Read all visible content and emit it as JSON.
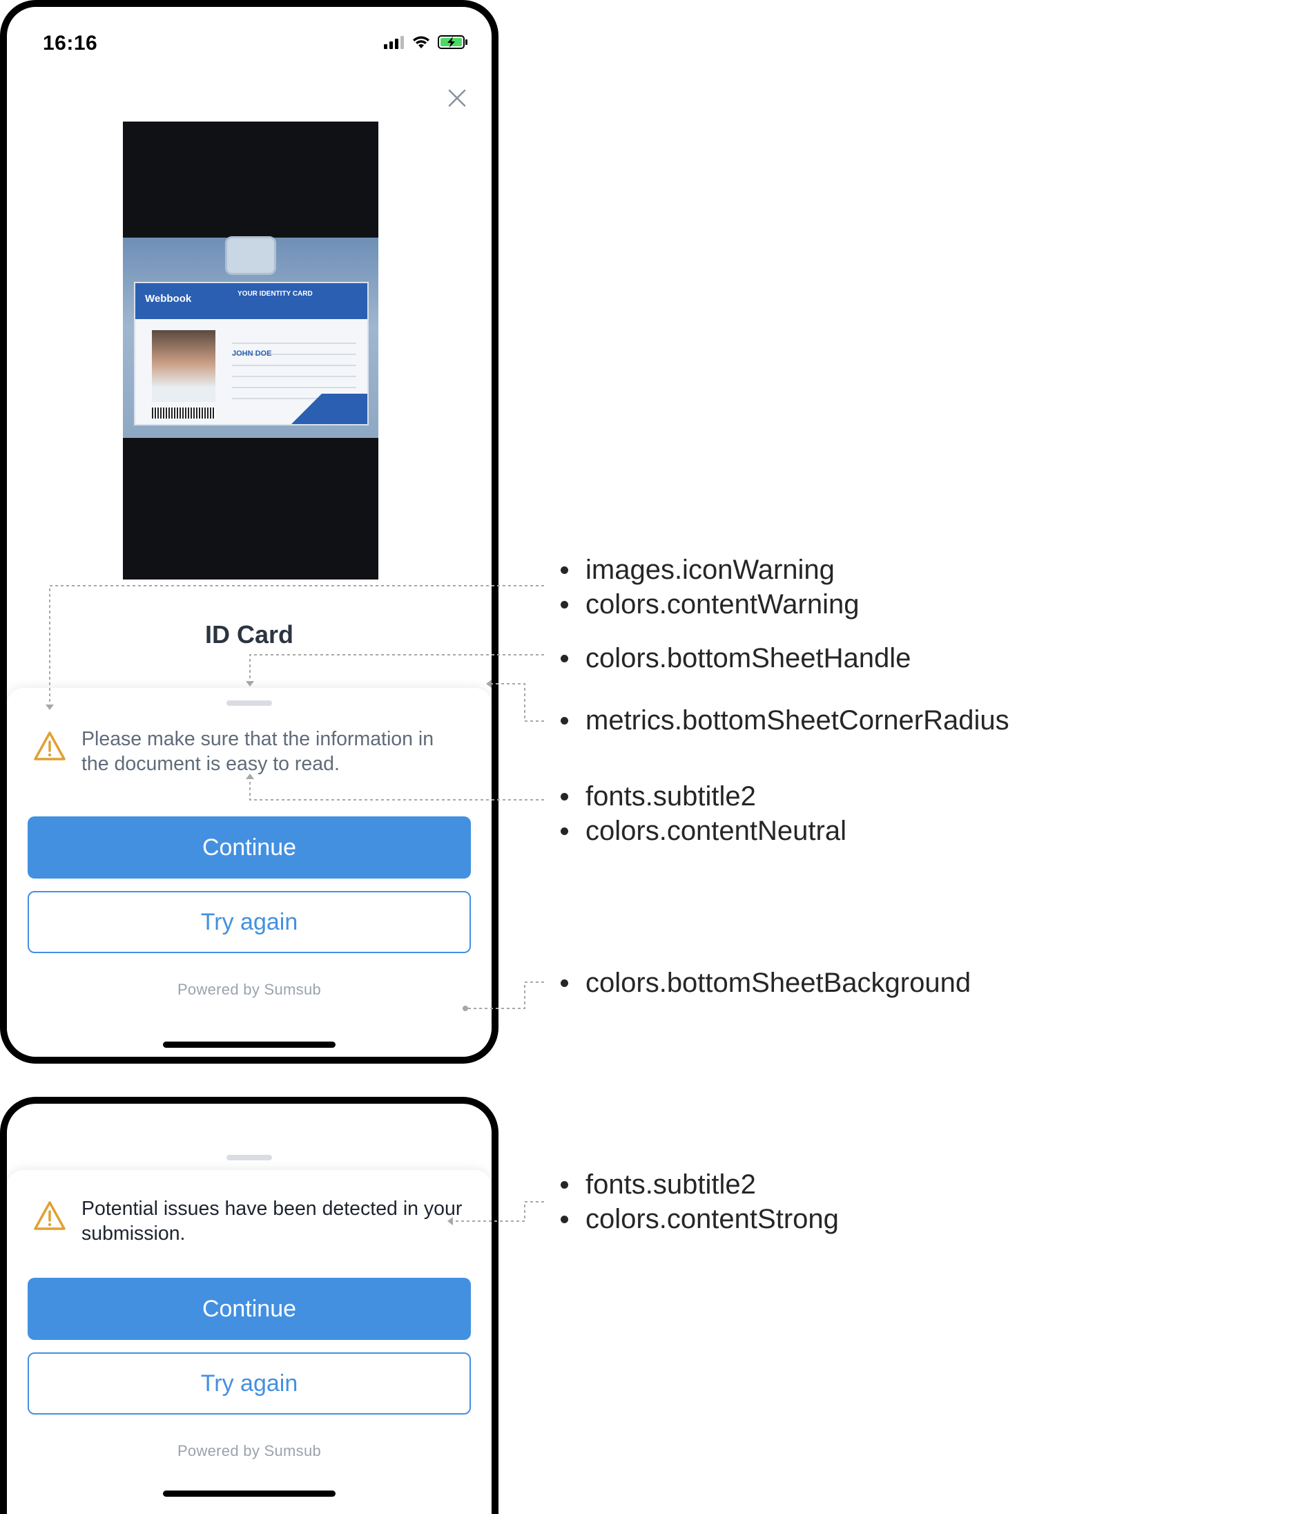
{
  "screen1": {
    "status": {
      "time": "16:16",
      "icons": [
        "signal-icon",
        "wifi-icon",
        "battery-charging-icon"
      ]
    },
    "close_icon": "close-icon",
    "document_title": "ID Card",
    "document_image": {
      "logo": "Webbook",
      "heading": "YOUR IDENTITY CARD",
      "name": "JOHN DOE"
    },
    "warning": {
      "icon": "warning-icon",
      "text": "Please make sure that the information in the document is easy to read."
    },
    "buttons": {
      "continue": "Continue",
      "try_again": "Try again"
    },
    "powered_by": "Powered by Sumsub"
  },
  "screen2": {
    "warning": {
      "icon": "warning-icon",
      "text": "Potential issues have been detected in your submission."
    },
    "buttons": {
      "continue": "Continue",
      "try_again": "Try again"
    },
    "powered_by": "Powered by Sumsub"
  },
  "annotations": [
    [
      "images.iconWarning",
      "colors.contentWarning"
    ],
    [
      "colors.bottomSheetHandle"
    ],
    [
      "metrics.bottomSheetCornerRadius"
    ],
    [
      "fonts.subtitle2",
      "colors.contentNeutral"
    ],
    [
      "colors.bottomSheetBackground"
    ],
    [
      "fonts.subtitle2",
      "colors.contentStrong"
    ]
  ],
  "colors": {
    "primary": "#4390e1",
    "contentWarning": "#e0a032",
    "contentNeutral": "#5f6b7a",
    "contentStrong": "#1e2530",
    "bottomSheetHandle": "#d9dde3",
    "bottomSheetBackground": "#ffffff"
  }
}
